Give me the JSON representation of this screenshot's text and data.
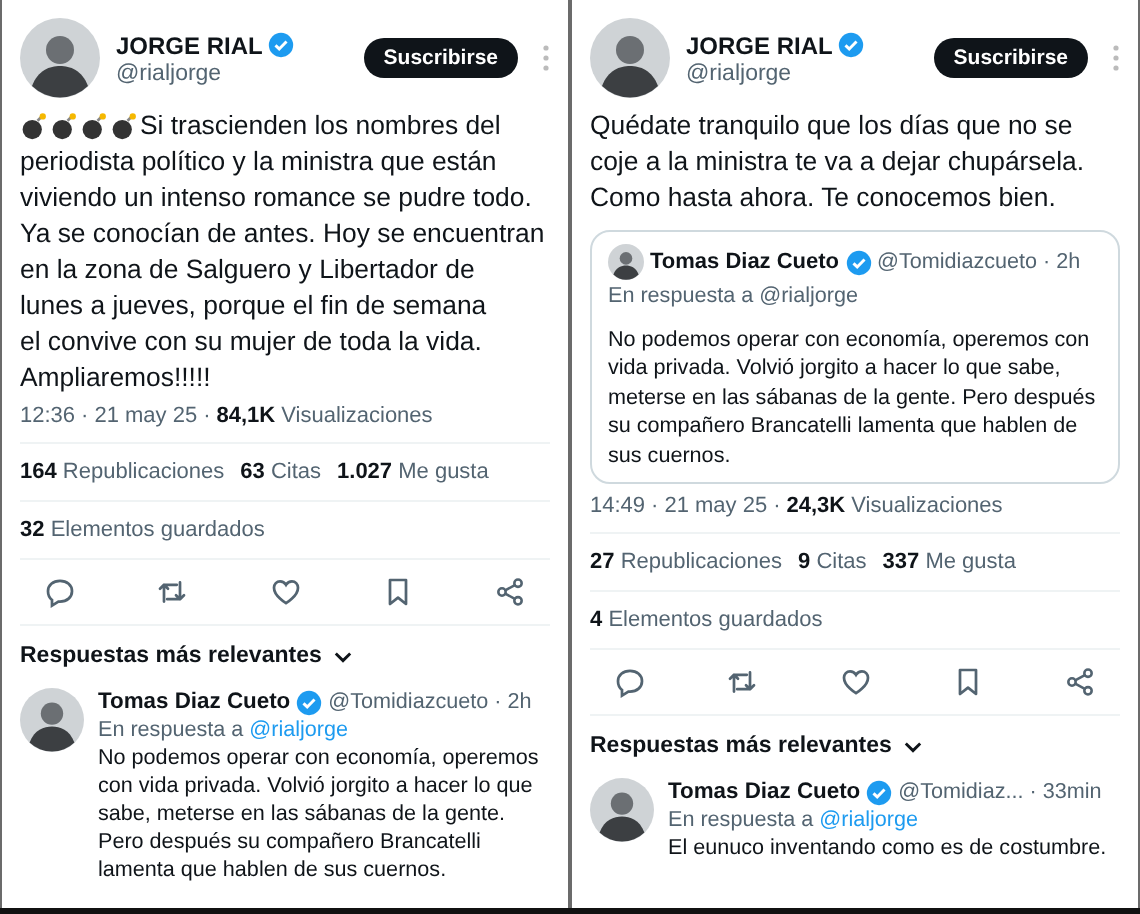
{
  "panels": [
    {
      "author": {
        "name": "JORGE RIAL",
        "handle": "@rialjorge",
        "verified": true
      },
      "subscribe_button": "Suscribirse",
      "lead_icons": [
        {
          "kind": "bomb"
        },
        {
          "kind": "bomb"
        },
        {
          "kind": "bomb"
        },
        {
          "kind": "bomb"
        }
      ],
      "text_lines": [
        "Si trascienden los nombres del",
        "periodista político y la ministra que están",
        "viviendo un intenso romance se pudre todo.",
        "Ya se conocían de antes. Hoy se encuentran",
        "en la zona de Salguero y Libertador de",
        "lunes a jueves, porque el fin de semana",
        "el convive con su mujer de toda la vida.",
        "Ampliaremos!!!!!"
      ],
      "meta": {
        "parts": [
          "12:36",
          "·",
          "21 may 25",
          "·"
        ],
        "views": "84,1K",
        "views_label": "Visualizaciones"
      },
      "stats": [
        {
          "count": "164",
          "label": "Republicaciones"
        },
        {
          "count": "63",
          "label": "Citas"
        },
        {
          "count": "1.027",
          "label": "Me gusta"
        }
      ],
      "saved": {
        "count": "32",
        "label": "Elementos guardados"
      },
      "actions": [
        {
          "kind": "reply"
        },
        {
          "kind": "repost"
        },
        {
          "kind": "like"
        },
        {
          "kind": "bookmark"
        },
        {
          "kind": "share"
        }
      ],
      "replies_header": "Respuestas más relevantes",
      "reply": {
        "name": "Tomas Diaz Cueto",
        "verified": true,
        "handle": "@Tomidiazcueto",
        "time": "· 2h",
        "in_reply_to": "En respuesta a",
        "mention": "@rialjorge",
        "text": "No podemos operar con economía, operemos con vida privada. Volvió jorgito a hacer lo que sabe, meterse en las sábanas de la gente. Pero después su compañero Brancatelli lamenta que hablen de sus cuernos."
      }
    },
    {
      "author": {
        "name": "JORGE RIAL",
        "handle": "@rialjorge",
        "verified": true
      },
      "subscribe_button": "Suscribirse",
      "text_lines": [
        "Quédate tranquilo que los días que no se",
        "coje a la ministra te va a dejar chupársela.",
        "Como hasta ahora. Te conocemos bien."
      ],
      "quote": {
        "name": "Tomas Diaz Cueto",
        "verified": true,
        "handle": "@Tomidiazcueto",
        "time": "· 2h",
        "in_reply_to": "En respuesta a @rialjorge",
        "text": "No podemos operar con economía, operemos con vida privada. Volvió jorgito a hacer lo que sabe, meterse en las sábanas de la gente. Pero después su compañero Brancatelli lamenta que hablen de sus cuernos."
      },
      "meta": {
        "parts": [
          "14:49",
          "·",
          "21 may 25",
          "·"
        ],
        "views": "24,3K",
        "views_label": "Visualizaciones"
      },
      "stats": [
        {
          "count": "27",
          "label": "Republicaciones"
        },
        {
          "count": "9",
          "label": "Citas"
        },
        {
          "count": "337",
          "label": "Me gusta"
        }
      ],
      "saved": {
        "count": "4",
        "label": "Elementos guardados"
      },
      "actions": [
        {
          "kind": "reply"
        },
        {
          "kind": "repost"
        },
        {
          "kind": "like"
        },
        {
          "kind": "bookmark"
        },
        {
          "kind": "share"
        }
      ],
      "replies_header": "Respuestas más relevantes",
      "reply": {
        "name": "Tomas Diaz Cueto",
        "verified": true,
        "handle": "@Tomidiaz...",
        "time": "· 33min",
        "in_reply_to": "En respuesta a",
        "mention": "@rialjorge",
        "text": "El eunuco inventando como es de costumbre."
      }
    }
  ]
}
